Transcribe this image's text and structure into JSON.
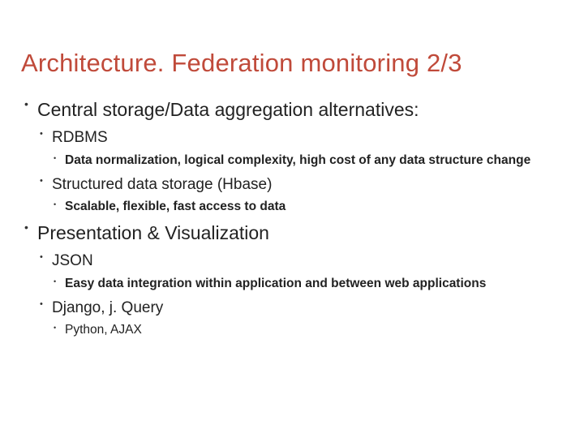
{
  "title": "Architecture. Federation monitoring 2/3",
  "bullets": [
    {
      "text": "Central storage/Data aggregation alternatives:",
      "children": [
        {
          "text": "RDBMS",
          "children": [
            {
              "text": "Data normalization, logical complexity, high cost of any data structure change"
            }
          ]
        },
        {
          "text": "Structured data storage (Hbase)",
          "children": [
            {
              "text": "Scalable, flexible, fast access to data"
            }
          ]
        }
      ]
    },
    {
      "text": "Presentation & Visualization",
      "children": [
        {
          "text": "JSON",
          "children": [
            {
              "text": "Easy data integration within application and between web applications"
            }
          ]
        },
        {
          "text": "Django, j. Query",
          "children": [
            {
              "text": "Python, AJAX",
              "nobold": true
            }
          ]
        }
      ]
    }
  ]
}
